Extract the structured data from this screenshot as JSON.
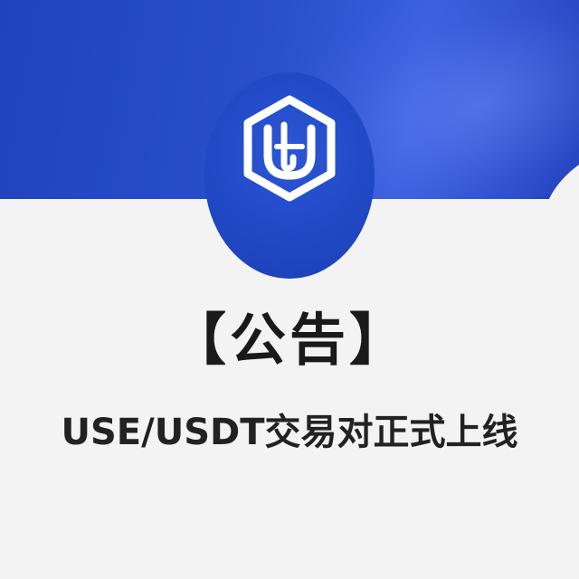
{
  "banner": {
    "logo_icon": "hexagon-u-logo-icon",
    "colors": {
      "primary": "#2149c6",
      "light": "#3a5fe0",
      "background": "#f3f3f4"
    }
  },
  "announcement": {
    "tag": "【公告】",
    "headline": "USE/USDT交易对正式上线"
  }
}
